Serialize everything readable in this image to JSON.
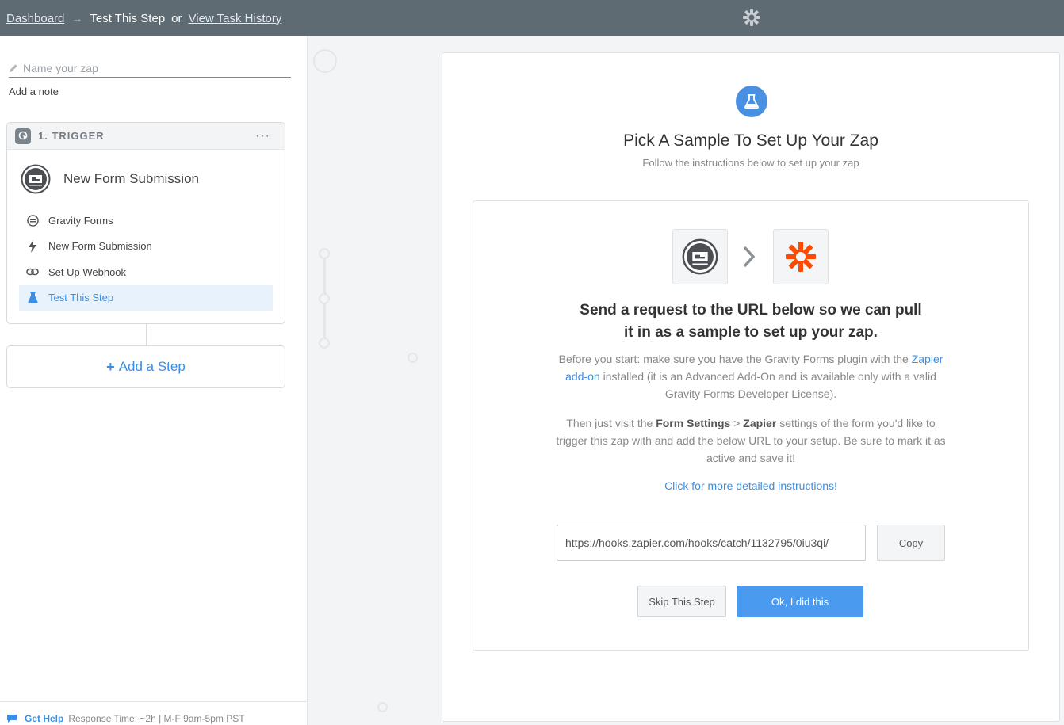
{
  "topbar": {
    "dashboard": "Dashboard",
    "current": "Test This Step",
    "or": "or",
    "history": "View Task History"
  },
  "sidebar": {
    "zap_name_placeholder": "Name your zap",
    "add_note": "Add a note",
    "trigger": {
      "label": "1. TRIGGER",
      "menu": "···",
      "title": "New Form Submission",
      "steps": [
        {
          "label": "Gravity Forms",
          "icon": "gravity-forms-icon"
        },
        {
          "label": "New Form Submission",
          "icon": "lightning-icon"
        },
        {
          "label": "Set Up Webhook",
          "icon": "link-icon"
        },
        {
          "label": "Test This Step",
          "icon": "flask-icon",
          "active": true
        }
      ]
    },
    "add_step": "Add a Step",
    "help": {
      "link": "Get Help",
      "response": "Response Time: ~2h | M-F 9am-5pm PST"
    }
  },
  "main": {
    "title": "Pick A Sample To Set Up Your Zap",
    "subtitle": "Follow the instructions below to set up your zap",
    "headline_line1": "Send a request to the URL below so we can pull",
    "headline_line2": "it in as a sample to set up your zap.",
    "p1_a": "Before you start: make sure you have the Gravity Forms plugin with the",
    "p1_link": "Zapier add-on",
    "p1_b": "installed (it is an Advanced Add-On and is available only with a valid Gravity Forms Developer License).",
    "p2_a": "Then just visit the",
    "p2_b1": "Form Settings",
    "p2_gt": ">",
    "p2_b2": "Zapier",
    "p2_c": "settings of the form you'd like to trigger this zap with and add the below URL to your setup. Be sure to mark it as active and save it!",
    "more_link": "Click for more detailed instructions!",
    "url": "https://hooks.zapier.com/hooks/catch/1132795/0iu3qi/",
    "copy": "Copy",
    "skip": "Skip This Step",
    "ok": "Ok, I did this"
  },
  "colors": {
    "accent": "#4a90e2",
    "topbar": "#5f6b73",
    "zapier_orange": "#ff4a00"
  }
}
